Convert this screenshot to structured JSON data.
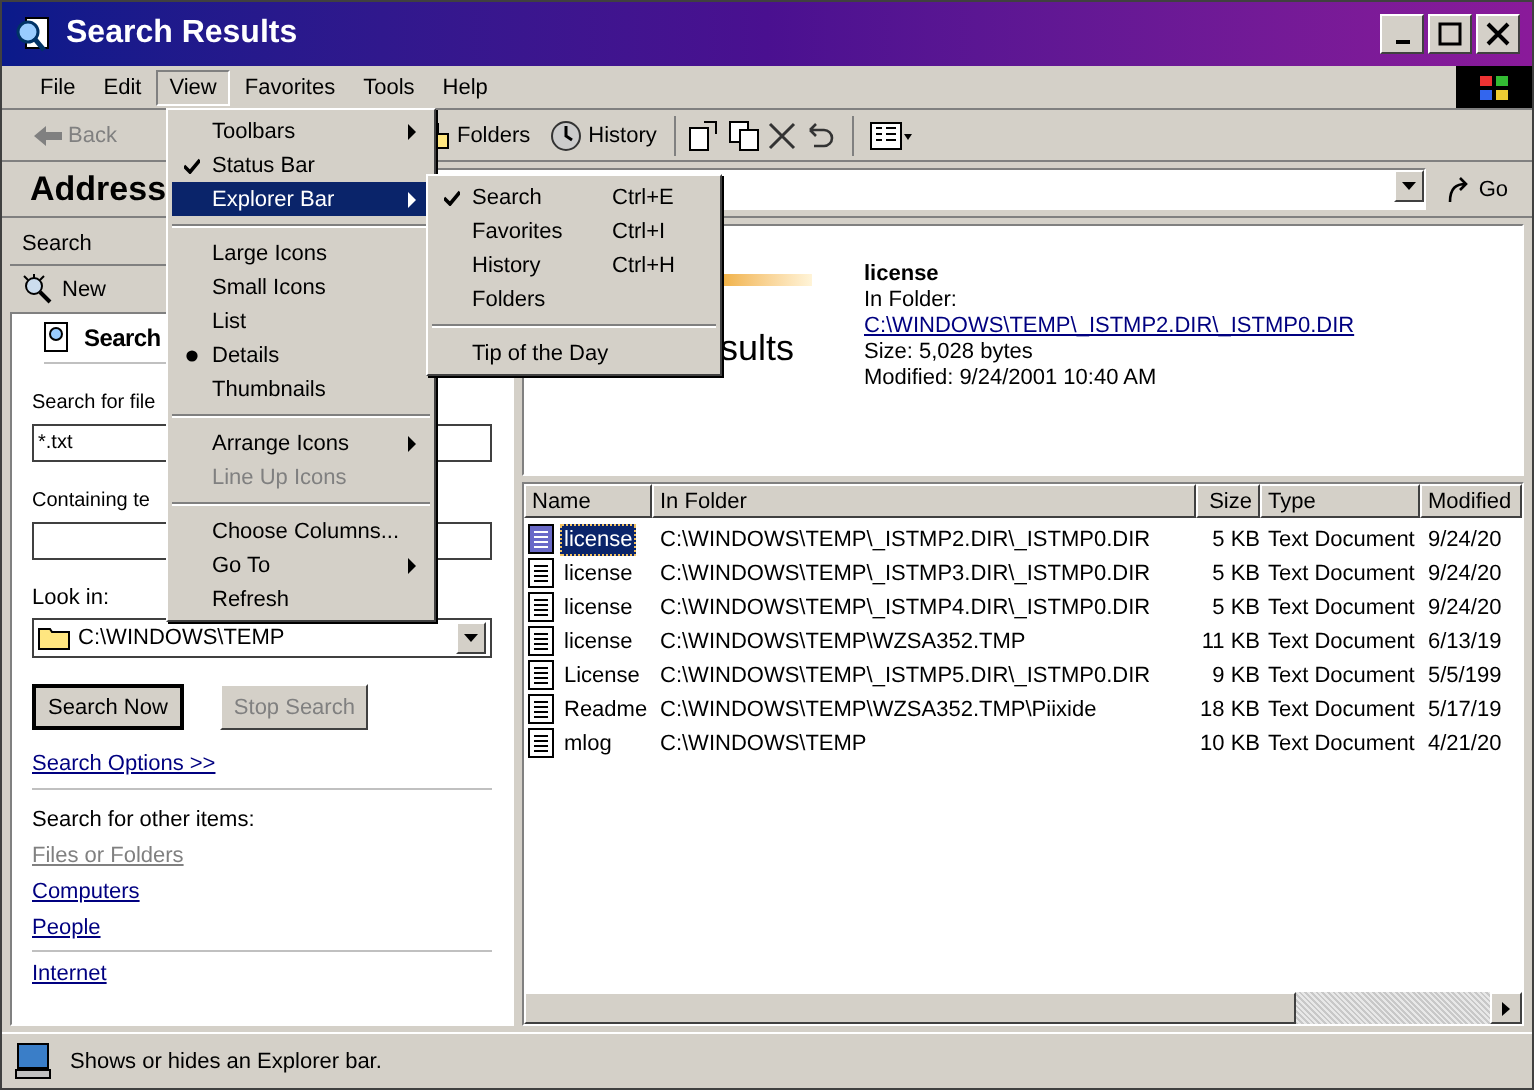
{
  "window": {
    "title": "Search Results"
  },
  "menu_bar": [
    {
      "label": "File",
      "selected": false
    },
    {
      "label": "Edit",
      "selected": false
    },
    {
      "label": "View",
      "selected": true
    },
    {
      "label": "Favorites",
      "selected": false
    },
    {
      "label": "Tools",
      "selected": false
    },
    {
      "label": "Help",
      "selected": false
    }
  ],
  "toolbar": {
    "back": "Back",
    "buttons": [
      {
        "kind": "folders",
        "label": "Folders"
      },
      {
        "kind": "history",
        "label": "History"
      }
    ]
  },
  "address_bar": {
    "label": "Address",
    "go": "Go"
  },
  "view_menu": [
    {
      "kind": "item",
      "label": "Toolbars",
      "submenu": true,
      "selected": false,
      "disabled": false
    },
    {
      "kind": "check",
      "label": "Status Bar",
      "checked": true,
      "submenu": false,
      "selected": false,
      "disabled": false
    },
    {
      "kind": "item",
      "label": "Explorer Bar",
      "submenu": true,
      "selected": true,
      "disabled": false
    },
    {
      "kind": "separator"
    },
    {
      "kind": "radio",
      "label": "Large Icons",
      "checked": false,
      "submenu": false,
      "selected": false,
      "disabled": false
    },
    {
      "kind": "radio",
      "label": "Small Icons",
      "checked": false,
      "submenu": false,
      "selected": false,
      "disabled": false
    },
    {
      "kind": "radio",
      "label": "List",
      "checked": false,
      "submenu": false,
      "selected": false,
      "disabled": false
    },
    {
      "kind": "radio",
      "label": "Details",
      "checked": true,
      "submenu": false,
      "selected": false,
      "disabled": false
    },
    {
      "kind": "radio",
      "label": "Thumbnails",
      "checked": false,
      "submenu": false,
      "selected": false,
      "disabled": false
    },
    {
      "kind": "separator"
    },
    {
      "kind": "item",
      "label": "Arrange Icons",
      "submenu": true,
      "selected": false,
      "disabled": false
    },
    {
      "kind": "item",
      "label": "Line Up Icons",
      "submenu": false,
      "selected": false,
      "disabled": true
    },
    {
      "kind": "separator"
    },
    {
      "kind": "item",
      "label": "Choose Columns...",
      "submenu": false,
      "selected": false,
      "disabled": false
    },
    {
      "kind": "item",
      "label": "Go To",
      "submenu": true,
      "selected": false,
      "disabled": false
    },
    {
      "kind": "item",
      "label": "Refresh",
      "submenu": false,
      "selected": false,
      "disabled": false
    }
  ],
  "explorer_bar_menu": [
    {
      "kind": "check",
      "label": "Search",
      "shortcut": "Ctrl+E",
      "checked": true
    },
    {
      "kind": "check",
      "label": "Favorites",
      "shortcut": "Ctrl+I",
      "checked": false
    },
    {
      "kind": "check",
      "label": "History",
      "shortcut": "Ctrl+H",
      "checked": false
    },
    {
      "kind": "check",
      "label": "Folders",
      "checked": false
    },
    {
      "kind": "separator"
    },
    {
      "kind": "item",
      "label": "Tip of the Day"
    }
  ],
  "search_pane": {
    "title": "Search",
    "new_button": "New",
    "heading": "Search",
    "fields": [
      {
        "label": "Search for file",
        "value": "*.txt"
      },
      {
        "label": "Containing te"
      }
    ],
    "look_in": {
      "label": "Look in:",
      "value": "C:\\WINDOWS\\TEMP"
    },
    "buttons": [
      {
        "label": "Search Now",
        "disabled": false
      },
      {
        "label": "Stop Search",
        "disabled": true
      }
    ],
    "options_link": "Search Options >>",
    "other_items_label": "Search for other items:",
    "other_links": [
      {
        "label": "Files or Folders",
        "disabled": true
      },
      {
        "label": "Computers",
        "disabled": false
      },
      {
        "label": "People",
        "disabled": false
      }
    ],
    "internet_link": "Internet"
  },
  "results": {
    "banner": "sults",
    "info": {
      "name": "license",
      "in_folder_label": "In Folder:",
      "path": "C:\\WINDOWS\\TEMP\\_ISTMP2.DIR\\_ISTMP0.DIR",
      "size": "Size: 5,028 bytes",
      "modified": "Modified: 9/24/2001 10:40 AM"
    },
    "columns": [
      "Name",
      "In Folder",
      "Size",
      "Type",
      "Modified"
    ],
    "rows": [
      {
        "name": "license",
        "folder": "C:\\WINDOWS\\TEMP\\_ISTMP2.DIR\\_ISTMP0.DIR",
        "size": "5 KB",
        "type": "Text Document",
        "modified": "9/24/20",
        "selected": true
      },
      {
        "name": "license",
        "folder": "C:\\WINDOWS\\TEMP\\_ISTMP3.DIR\\_ISTMP0.DIR",
        "size": "5 KB",
        "type": "Text Document",
        "modified": "9/24/20",
        "selected": false
      },
      {
        "name": "license",
        "folder": "C:\\WINDOWS\\TEMP\\_ISTMP4.DIR\\_ISTMP0.DIR",
        "size": "5 KB",
        "type": "Text Document",
        "modified": "9/24/20",
        "selected": false
      },
      {
        "name": "license",
        "folder": "C:\\WINDOWS\\TEMP\\WZSA352.TMP",
        "size": "11 KB",
        "type": "Text Document",
        "modified": "6/13/19",
        "selected": false
      },
      {
        "name": "License",
        "folder": "C:\\WINDOWS\\TEMP\\_ISTMP5.DIR\\_ISTMP0.DIR",
        "size": "9 KB",
        "type": "Text Document",
        "modified": "5/5/199",
        "selected": false
      },
      {
        "name": "Readme",
        "folder": "C:\\WINDOWS\\TEMP\\WZSA352.TMP\\Piixide",
        "size": "18 KB",
        "type": "Text Document",
        "modified": "5/17/19",
        "selected": false
      },
      {
        "name": "mlog",
        "folder": "C:\\WINDOWS\\TEMP",
        "size": "10 KB",
        "type": "Text Document",
        "modified": "4/21/20",
        "selected": false
      }
    ]
  },
  "status_bar": {
    "text": "Shows or hides an Explorer bar."
  }
}
